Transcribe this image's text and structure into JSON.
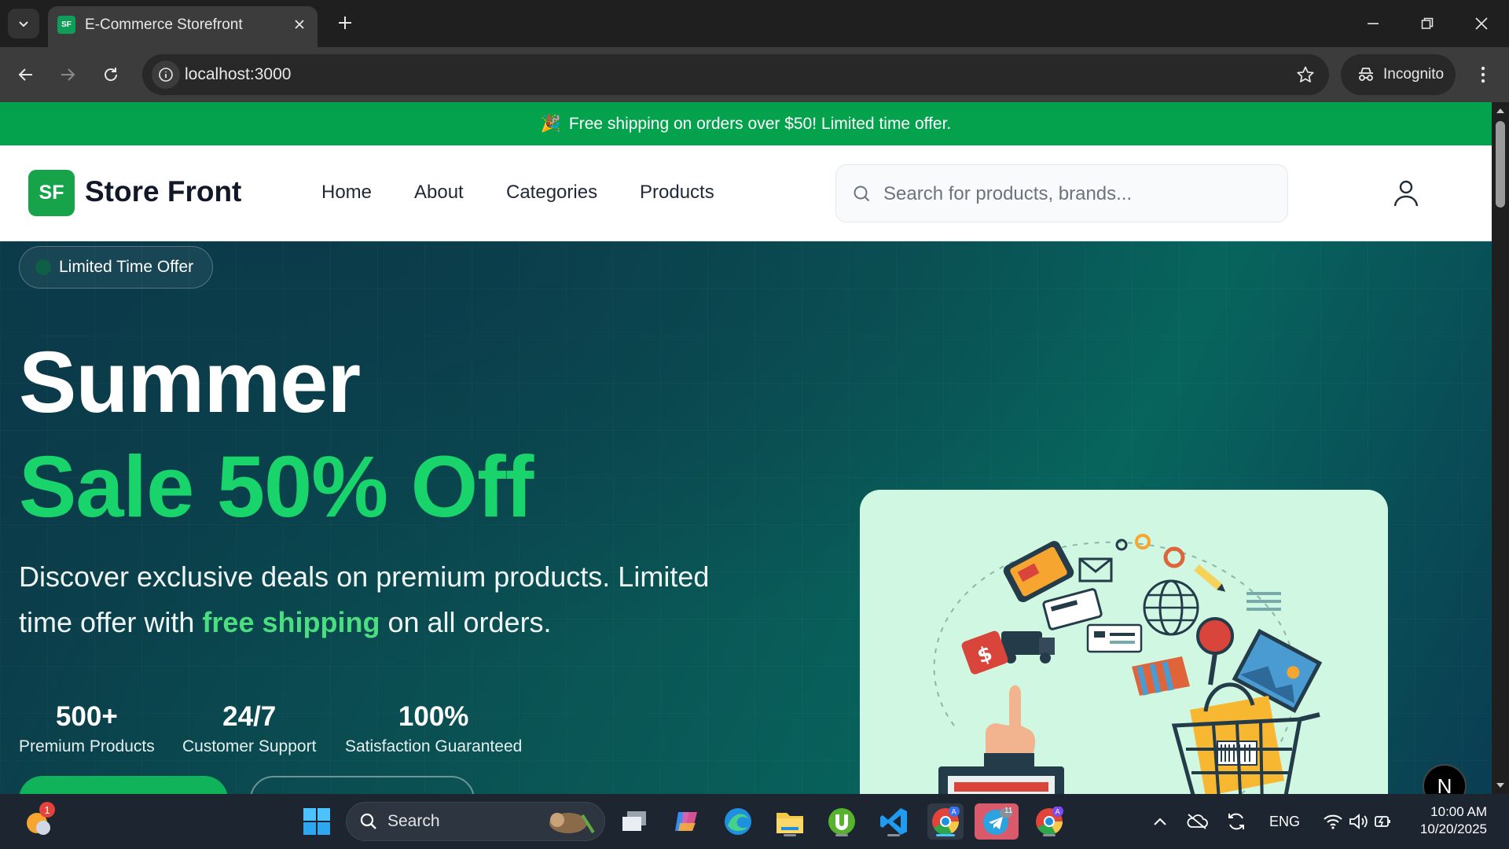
{
  "browser": {
    "tab_title": "E-Commerce Storefront",
    "tab_favicon_text": "SF",
    "url": "localhost:3000",
    "profile_label": "Incognito"
  },
  "announcement": {
    "emoji": "🎉",
    "text": "Free shipping on orders over $50! Limited time offer."
  },
  "header": {
    "logo_mark": "SF",
    "logo_text": "Store Front",
    "nav": [
      "Home",
      "About",
      "Categories",
      "Products"
    ],
    "search_placeholder": "Search for products, brands..."
  },
  "hero": {
    "badge": "Limited Time Offer",
    "title_line1": "Summer",
    "title_line2": "Sale 50% Off",
    "desc_before": "Discover exclusive deals on premium products. Limited time offer with ",
    "desc_highlight": "free shipping",
    "desc_after": " on all orders.",
    "stats": [
      {
        "value": "500+",
        "label": "Premium Products"
      },
      {
        "value": "24/7",
        "label": "Customer Support"
      },
      {
        "value": "100%",
        "label": "Satisfaction Guaranteed"
      }
    ]
  },
  "dev_badge": "N",
  "taskbar": {
    "search_label": "Search",
    "notification_count": "1",
    "telegram_count": "11",
    "language": "ENG",
    "time": "10:00 AM",
    "date": "10/20/2025"
  },
  "colors": {
    "announcement_bg": "#04a24c",
    "brand_green": "#16a34a",
    "hero_accent": "#18d46a",
    "hero_card_bg": "#cff7e2"
  }
}
